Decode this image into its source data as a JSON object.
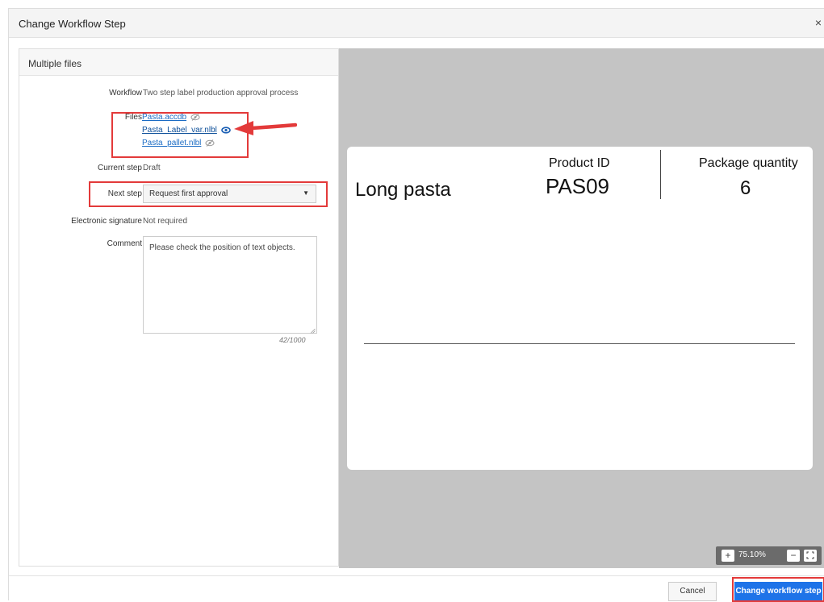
{
  "dialog": {
    "title": "Change Workflow Step",
    "close_glyph": "×"
  },
  "left": {
    "header": "Multiple files",
    "workflow": {
      "label": "Workflow",
      "value": "Two step label production approval process"
    },
    "files": {
      "label": "Files",
      "items": [
        {
          "name": "Pasta.accdb",
          "icon": "eye-slash-icon"
        },
        {
          "name": "Pasta_Label_var.nlbl",
          "icon": "eye-icon"
        },
        {
          "name": "Pasta_pallet.nlbl",
          "icon": "eye-slash-icon"
        }
      ]
    },
    "current_step": {
      "label": "Current step",
      "value": "Draft"
    },
    "next_step": {
      "label": "Next step",
      "value": "Request first approval"
    },
    "signature": {
      "label": "Electronic signature",
      "value": "Not required"
    },
    "comment": {
      "label": "Comment",
      "value": "Please check the position of text objects.",
      "count": "42/1000"
    }
  },
  "preview": {
    "product_name": "Long pasta",
    "product_id_header": "Product ID",
    "product_id": "PAS09",
    "package_qty_header": "Package quantity",
    "package_qty": "6",
    "zoom": "75.10%"
  },
  "footer": {
    "cancel": "Cancel",
    "primary": "Change workflow step"
  },
  "colors": {
    "accent": "#1e73e8",
    "highlight": "#e33a3a",
    "link": "#1a6bc4",
    "preview_bg": "#c4c4c4"
  }
}
